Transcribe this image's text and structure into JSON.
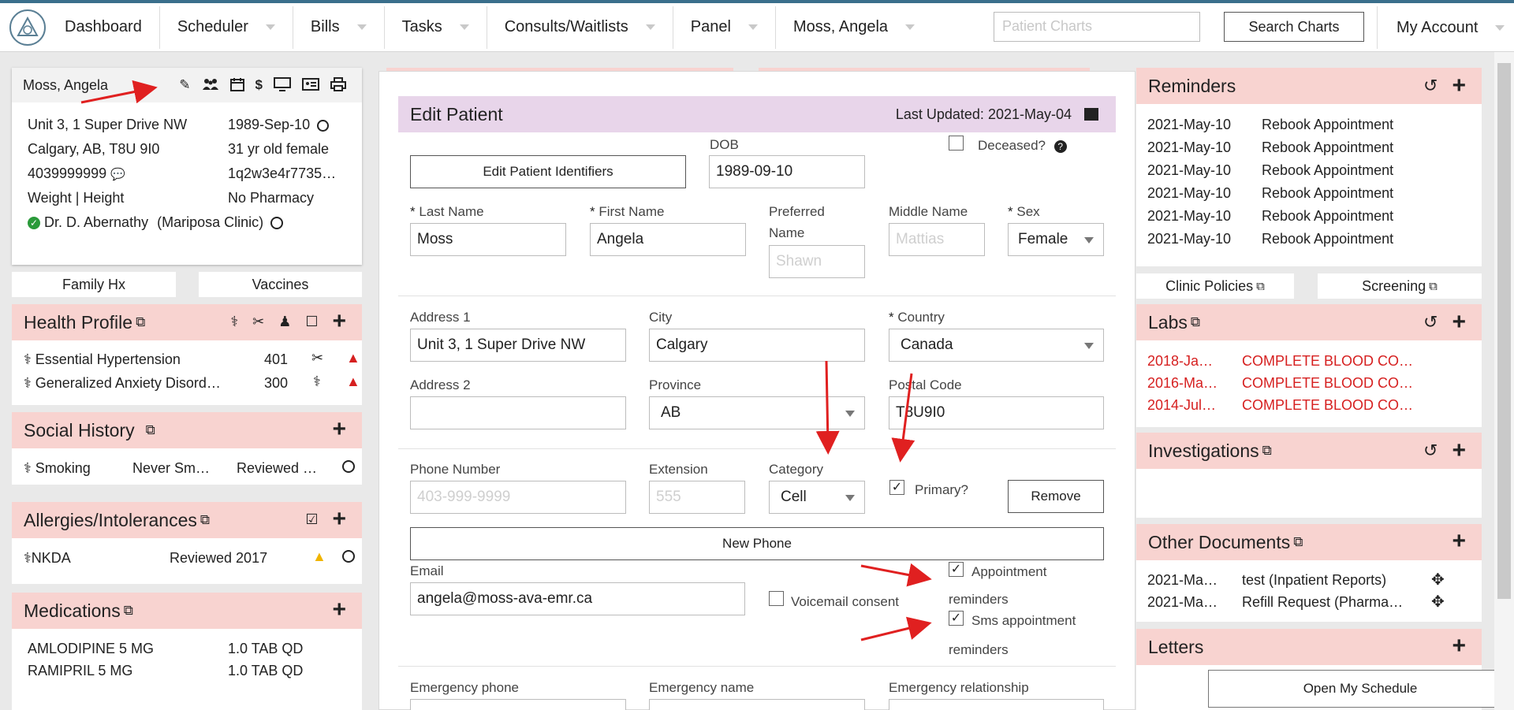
{
  "nav": {
    "items": [
      "Dashboard",
      "Scheduler",
      "Bills",
      "Tasks",
      "Consults/Waitlists",
      "Panel",
      "Moss, Angela"
    ],
    "search_placeholder": "Patient Charts",
    "search_button": "Search Charts",
    "account": "My Account"
  },
  "patient_card": {
    "name": "Moss, Angela",
    "address1": "Unit 3, 1 Super Drive NW",
    "address2": "Calgary, AB, T8U 9I0",
    "phone": "4039999999",
    "weight_height": "Weight | Height",
    "provider": "Dr. D. Abernathy",
    "clinic": "(Mariposa Clinic)",
    "dob": "1989-Sep-10",
    "age_sex": "31 yr old female",
    "hash": "1q2w3e4r7735…",
    "pharmacy": "No Pharmacy"
  },
  "left_tabs": [
    "Family Hx",
    "Vaccines"
  ],
  "health_profile": {
    "title": "Health Profile",
    "items": [
      {
        "name": "Essential Hypertension",
        "code": "401"
      },
      {
        "name": "Generalized Anxiety Disord…",
        "code": "300"
      }
    ]
  },
  "social_history": {
    "title": "Social History",
    "item": "Smoking",
    "value": "Never Sm…",
    "status": "Reviewed …"
  },
  "allergies": {
    "title": "Allergies/Intolerances",
    "item": "NKDA",
    "status": "Reviewed 2017"
  },
  "medications": {
    "title": "Medications",
    "items": [
      {
        "name": "AMLODIPINE 5 MG",
        "dose": "1.0 TAB QD"
      },
      {
        "name": "RAMIPRIL 5 MG",
        "dose": "1.0 TAB QD"
      }
    ]
  },
  "form": {
    "title": "Edit Patient",
    "last_updated": "Last Updated: 2021-May-04",
    "edit_identifiers": "Edit Patient Identifiers",
    "dob_label": "DOB",
    "dob_value": "1989-09-10",
    "deceased_label": "Deceased?",
    "last_name_label": "Last Name",
    "last_name": "Moss",
    "first_name_label": "First Name",
    "first_name": "Angela",
    "preferred_name_label1": "Preferred",
    "preferred_name_label2": "Name",
    "preferred_name_ph": "Shawn",
    "middle_name_label": "Middle Name",
    "middle_name_ph": "Mattias",
    "sex_label": "Sex",
    "sex_value": "Female",
    "address1_label": "Address 1",
    "address1_value": "Unit 3, 1 Super Drive NW",
    "city_label": "City",
    "city_value": "Calgary",
    "country_label": "Country",
    "country_value": "Canada",
    "address2_label": "Address 2",
    "province_label": "Province",
    "province_value": "AB",
    "postal_label": "Postal Code",
    "postal_value": "T8U9I0",
    "phone_label": "Phone Number",
    "phone_ph": "403-999-9999",
    "ext_label": "Extension",
    "ext_ph": "555",
    "category_label": "Category",
    "category_value": "Cell",
    "primary_label": "Primary?",
    "remove_button": "Remove",
    "new_phone_button": "New Phone",
    "email_label": "Email",
    "email_value": "angela@moss-ava-emr.ca",
    "voicemail_label": "Voicemail consent",
    "appt_label1": "Appointment",
    "appt_label2": "reminders",
    "sms_label1": "Sms appointment",
    "sms_label2": "reminders",
    "emerg_phone_label": "Emergency phone",
    "emerg_name_label": "Emergency name",
    "emerg_rel_label": "Emergency relationship"
  },
  "reminders": {
    "title": "Reminders",
    "items": [
      {
        "date": "2021-May-10",
        "text": "Rebook Appointment"
      },
      {
        "date": "2021-May-10",
        "text": "Rebook Appointment"
      },
      {
        "date": "2021-May-10",
        "text": "Rebook Appointment"
      },
      {
        "date": "2021-May-10",
        "text": "Rebook Appointment"
      },
      {
        "date": "2021-May-10",
        "text": "Rebook Appointment"
      },
      {
        "date": "2021-May-10",
        "text": "Rebook Appointment"
      }
    ]
  },
  "right_tabs": [
    "Clinic Policies",
    "Screening"
  ],
  "labs": {
    "title": "Labs",
    "items": [
      {
        "date": "2018-Ja…",
        "text": "COMPLETE BLOOD CO…"
      },
      {
        "date": "2016-Ma…",
        "text": "COMPLETE BLOOD CO…"
      },
      {
        "date": "2014-Jul…",
        "text": "COMPLETE BLOOD CO…"
      }
    ]
  },
  "investigations": {
    "title": "Investigations"
  },
  "other_documents": {
    "title": "Other Documents",
    "items": [
      {
        "date": "2021-Ma…",
        "text": "test (Inpatient Reports)"
      },
      {
        "date": "2021-Ma…",
        "text": "Refill Request (Pharma…"
      }
    ]
  },
  "letters": {
    "title": "Letters"
  },
  "open_schedule": "Open My Schedule",
  "colors": {
    "section_header": "#f8d3d0",
    "form_header": "#e8d5ea",
    "alert_red": "#d62020",
    "annotation_arrow": "#e02020"
  }
}
